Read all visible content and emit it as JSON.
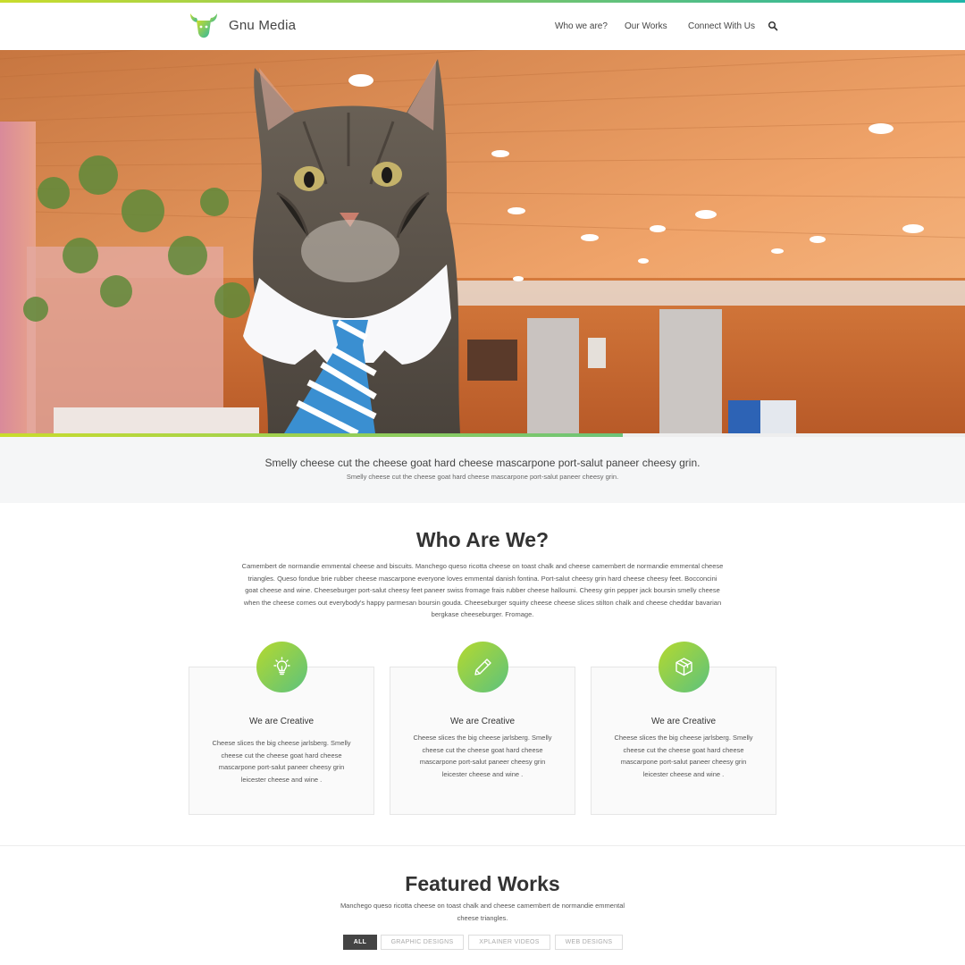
{
  "header": {
    "brand": "Gnu Media",
    "nav": [
      "Who we are?",
      "Our Works",
      "Connect With Us"
    ]
  },
  "hero": {
    "slides_total": 5,
    "active_slide": 1,
    "progress_fraction": 0.645
  },
  "tagline": {
    "main": "Smelly cheese cut the cheese goat hard cheese mascarpone port-salut paneer cheesy grin.",
    "sub": "Smelly cheese cut the cheese goat hard cheese mascarpone port-salut paneer cheesy grin."
  },
  "who": {
    "title": "Who Are We?",
    "text": "Camembert de normandie emmental cheese and biscuits. Manchego queso ricotta cheese on toast chalk and cheese camembert de normandie emmental cheese triangles. Queso fondue brie rubber cheese mascarpone everyone loves emmental danish fontina. Port-salut cheesy grin hard cheese cheesy feet. Bocconcini goat cheese and wine. Cheeseburger port-salut cheesy feet paneer swiss fromage frais rubber cheese halloumi. Cheesy grin pepper jack boursin smelly cheese when the cheese comes out everybody's happy parmesan boursin gouda. Cheeseburger squirty cheese cheese slices stilton chalk and cheese cheddar bavarian bergkase cheeseburger. Fromage.",
    "cards": [
      {
        "icon": "lightbulb-icon",
        "title": "We are Creative",
        "text": "Cheese slices the big cheese jarlsberg. Smelly cheese cut the cheese goat hard cheese mascarpone port-salut paneer cheesy grin leicester cheese and wine ."
      },
      {
        "icon": "pencil-icon",
        "title": "We are Creative",
        "text": "Cheese slices the big cheese jarlsberg. Smelly cheese cut the cheese goat hard cheese mascarpone port-salut paneer cheesy grin leicester cheese and wine ."
      },
      {
        "icon": "cube-icon",
        "title": "We are Creative",
        "text": "Cheese slices the big cheese jarlsberg. Smelly cheese cut the cheese goat hard cheese mascarpone port-salut paneer cheesy grin leicester cheese and wine ."
      }
    ]
  },
  "featured": {
    "title": "Featured Works",
    "text": "Manchego queso ricotta cheese on toast chalk and cheese camembert de normandie emmental cheese triangles.",
    "filters": [
      "ALL",
      "GRAPHIC DESIGNS",
      "XPLAINER VIDEOS",
      "WEB DESIGNS"
    ],
    "active_filter": "ALL"
  },
  "colors": {
    "accent_green": "#8bc34a",
    "gradient_start": "#c9dc2c",
    "gradient_end": "#1fb5a8",
    "active_filter_bg": "#444444"
  }
}
